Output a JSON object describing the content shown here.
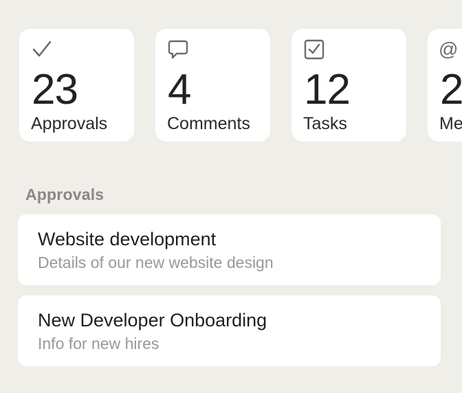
{
  "summary": {
    "cards": [
      {
        "icon": "checkmark-icon",
        "count": "23",
        "label": "Approvals"
      },
      {
        "icon": "comment-bubble-icon",
        "count": "4",
        "label": "Comments"
      },
      {
        "icon": "checkbox-icon",
        "count": "12",
        "label": "Tasks"
      },
      {
        "icon": "at-sign-icon",
        "count": "2",
        "label": "Me",
        "glyph": "@"
      }
    ]
  },
  "approvals": {
    "title": "Approvals",
    "items": [
      {
        "title": "Website development",
        "subtitle": "Details of our new website design"
      },
      {
        "title": "New Developer Onboarding",
        "subtitle": "Info for new hires"
      }
    ]
  }
}
